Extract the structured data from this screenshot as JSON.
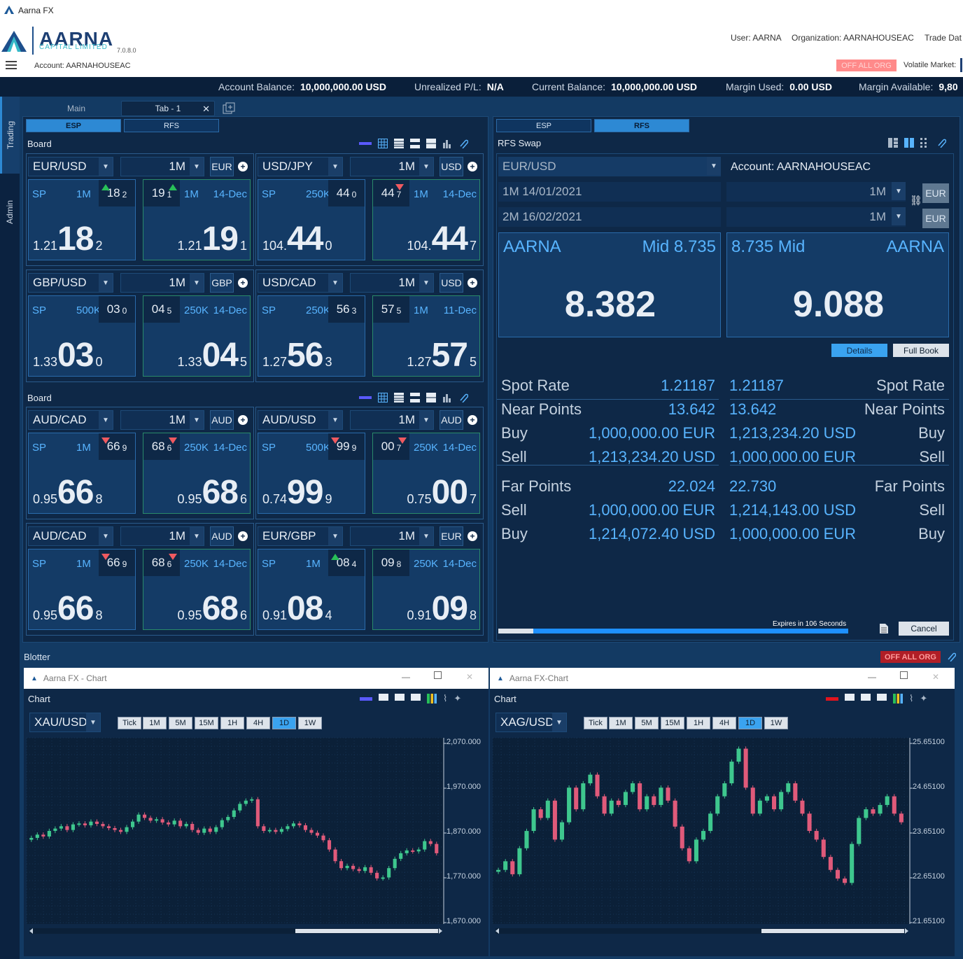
{
  "app": {
    "title": "Aarna FX",
    "logo_main": "AARNA",
    "logo_sub": "CAPITAL LIMITED",
    "version": "7.0.8.0"
  },
  "header": {
    "user": "User: AARNA",
    "organization": "Organization: AARNAHOUSEAC",
    "trade_date": "Trade Dat",
    "account": "Account: AARNAHOUSEAC",
    "off_all_org": "OFF ALL ORG",
    "volatile_market": "Volatile Market:"
  },
  "balances": [
    {
      "label": "Account Balance:",
      "value": "10,000,000.00 USD"
    },
    {
      "label": "Unrealized P/L:",
      "value": "N/A"
    },
    {
      "label": "Current Balance:",
      "value": "10,000,000.00 USD"
    },
    {
      "label": "Margin Used:",
      "value": "0.00 USD"
    },
    {
      "label": "Margin Available:",
      "value": "9,80"
    }
  ],
  "rail": {
    "trading": "Trading",
    "admin": "Admin"
  },
  "tabs": {
    "main": "Main",
    "tab1": "Tab - 1"
  },
  "left_panel": {
    "esp": "ESP",
    "rfs": "RFS",
    "board1": "Board",
    "board2": "Board"
  },
  "tiles": [
    {
      "pair": "EUR/USD",
      "tenor": "1M",
      "ccy": "EUR",
      "sell": {
        "lbl": "SP",
        "amt": "1M",
        "pip": "18",
        "sub": "2",
        "pre": "1.21",
        "big": "18",
        "last": "2"
      },
      "buy": {
        "pip": "19",
        "sub": "1",
        "amt": "1M",
        "date": "14-Dec",
        "pre": "1.21",
        "big": "19",
        "last": "1"
      },
      "dir": "up"
    },
    {
      "pair": "USD/JPY",
      "tenor": "1M",
      "ccy": "USD",
      "sell": {
        "lbl": "SP",
        "amt": "250K",
        "pip": "44",
        "sub": "0",
        "pre": "104.",
        "big": "44",
        "last": "0"
      },
      "buy": {
        "pip": "44",
        "sub": "7",
        "amt": "1M",
        "date": "14-Dec",
        "pre": "104.",
        "big": "44",
        "last": "7"
      },
      "dir": "down_buy"
    },
    {
      "pair": "GBP/USD",
      "tenor": "1M",
      "ccy": "GBP",
      "sell": {
        "lbl": "SP",
        "amt": "500K",
        "pip": "03",
        "sub": "0",
        "pre": "1.33",
        "big": "03",
        "last": "0"
      },
      "buy": {
        "pip": "04",
        "sub": "5",
        "amt": "250K",
        "date": "14-Dec",
        "pre": "1.33",
        "big": "04",
        "last": "5"
      },
      "dir": "none"
    },
    {
      "pair": "USD/CAD",
      "tenor": "1M",
      "ccy": "USD",
      "sell": {
        "lbl": "SP",
        "amt": "250K",
        "pip": "56",
        "sub": "3",
        "pre": "1.27",
        "big": "56",
        "last": "3"
      },
      "buy": {
        "pip": "57",
        "sub": "5",
        "amt": "1M",
        "date": "11-Dec",
        "pre": "1.27",
        "big": "57",
        "last": "5"
      },
      "dir": "none"
    },
    {
      "pair": "AUD/CAD",
      "tenor": "1M",
      "ccy": "AUD",
      "sell": {
        "lbl": "SP",
        "amt": "1M",
        "pip": "66",
        "sub": "9",
        "pre": "0.95",
        "big": "66",
        "last": "8"
      },
      "buy": {
        "pip": "68",
        "sub": "6",
        "amt": "250K",
        "date": "14-Dec",
        "pre": "0.95",
        "big": "68",
        "last": "6"
      },
      "dir": "down"
    },
    {
      "pair": "AUD/USD",
      "tenor": "1M",
      "ccy": "AUD",
      "sell": {
        "lbl": "SP",
        "amt": "500K",
        "pip": "99",
        "sub": "9",
        "pre": "0.74",
        "big": "99",
        "last": "9"
      },
      "buy": {
        "pip": "00",
        "sub": "7",
        "amt": "250K",
        "date": "14-Dec",
        "pre": "0.75",
        "big": "00",
        "last": "7"
      },
      "dir": "down"
    },
    {
      "pair": "AUD/CAD",
      "tenor": "1M",
      "ccy": "AUD",
      "sell": {
        "lbl": "SP",
        "amt": "1M",
        "pip": "66",
        "sub": "9",
        "pre": "0.95",
        "big": "66",
        "last": "8"
      },
      "buy": {
        "pip": "68",
        "sub": "6",
        "amt": "250K",
        "date": "14-Dec",
        "pre": "0.95",
        "big": "68",
        "last": "6"
      },
      "dir": "down"
    },
    {
      "pair": "EUR/GBP",
      "tenor": "1M",
      "ccy": "EUR",
      "sell": {
        "lbl": "SP",
        "amt": "1M",
        "pip": "08",
        "sub": "4",
        "pre": "0.91",
        "big": "08",
        "last": "4"
      },
      "buy": {
        "pip": "09",
        "sub": "8",
        "amt": "250K",
        "date": "14-Dec",
        "pre": "0.91",
        "big": "09",
        "last": "8"
      },
      "dir": "up_sell"
    }
  ],
  "rfs": {
    "esp": "ESP",
    "rfs": "RFS",
    "title": "RFS Swap",
    "pair": "EUR/USD",
    "account": "Account:  AARNAHOUSEAC",
    "near_date": "1M 14/01/2021",
    "far_date": "2M 16/02/2021",
    "near_tenor": "1M",
    "far_tenor": "1M",
    "ccy1": "EUR",
    "ccy2": "EUR",
    "left_name": "AARNA",
    "left_mid": "Mid 8.735",
    "left_price": "8.382",
    "right_mid": "8.735 Mid",
    "right_name": "AARNA",
    "right_price": "9.088",
    "details": "Details",
    "fullbook": "Full Book",
    "expires": "Expires in 106 Seconds",
    "cancel": "Cancel",
    "progress": 0.1,
    "rows": [
      {
        "l": "Spot Rate",
        "lv": "1.21187",
        "rv": "1.21187",
        "r": "Spot Rate"
      },
      {
        "l": "Near Points",
        "lv": "13.642",
        "rv": "13.642",
        "r": "Near Points"
      },
      {
        "l": "Buy",
        "lv": "1,000,000.00 EUR",
        "rv": "1,213,234.20 USD",
        "r": "Buy"
      },
      {
        "l": "Sell",
        "lv": "1,213,234.20 USD",
        "rv": "1,000,000.00 EUR",
        "r": "Sell"
      },
      {
        "l": "Far Points",
        "lv": "22.024",
        "rv": "22.730",
        "r": "Far Points"
      },
      {
        "l": "Sell",
        "lv": "1,000,000.00 EUR",
        "rv": "1,214,143.00 USD",
        "r": "Sell"
      },
      {
        "l": "Buy",
        "lv": "1,214,072.40 USD",
        "rv": "1,000,000.00 EUR",
        "r": "Buy"
      }
    ]
  },
  "blotter": {
    "title": "Blotter",
    "off_all_org": "OFF ALL ORG"
  },
  "charts": [
    {
      "win_title": "Aarna FX - Chart",
      "title": "Chart",
      "symbol": "XAU/USD",
      "timeframes": [
        "Tick",
        "1M",
        "5M",
        "15M",
        "1H",
        "4H",
        "1D",
        "1W"
      ],
      "active_tf": "1D",
      "yticks": [
        "2,070.000",
        "1,970.000",
        "1,870.000",
        "1,770.000",
        "1,670.000"
      ],
      "ymin": 1670,
      "ymax": 2070,
      "close": [
        1855,
        1862,
        1858,
        1870,
        1875,
        1880,
        1872,
        1884,
        1886,
        1882,
        1890,
        1885,
        1880,
        1876,
        1872,
        1868,
        1878,
        1890,
        1905,
        1898,
        1892,
        1895,
        1888,
        1884,
        1892,
        1880,
        1885,
        1872,
        1866,
        1875,
        1868,
        1878,
        1893,
        1900,
        1914,
        1928,
        1935,
        1938,
        1880,
        1870,
        1872,
        1868,
        1874,
        1880,
        1886,
        1882,
        1872,
        1866,
        1860,
        1850,
        1830,
        1805,
        1790,
        1795,
        1788,
        1784,
        1792,
        1780,
        1768,
        1770,
        1790,
        1810,
        1822,
        1828,
        1826,
        1830,
        1848,
        1842,
        1822
      ]
    },
    {
      "win_title": "Aarna FX-Chart",
      "title": "Chart",
      "symbol": "XAG/USD",
      "timeframes": [
        "Tick",
        "1M",
        "5M",
        "15M",
        "1H",
        "4H",
        "1D",
        "1W"
      ],
      "active_tf": "1D",
      "yticks": [
        "25.65100",
        "24.65100",
        "23.65100",
        "22.65100",
        "21.65100"
      ],
      "ymin": 21.651,
      "ymax": 25.951,
      "close": [
        22.9,
        23.1,
        22.8,
        23.4,
        23.8,
        24.3,
        24.1,
        24.5,
        23.6,
        24.0,
        24.8,
        24.3,
        24.9,
        25.1,
        24.6,
        24.2,
        24.5,
        24.4,
        24.7,
        24.9,
        24.3,
        24.6,
        24.4,
        24.8,
        24.5,
        23.9,
        23.4,
        23.1,
        23.6,
        23.8,
        24.2,
        24.6,
        24.9,
        25.4,
        25.7,
        24.8,
        24.2,
        24.5,
        24.6,
        24.3,
        24.7,
        24.9,
        24.5,
        24.2,
        23.8,
        23.6,
        23.2,
        22.9,
        22.7,
        22.6,
        23.5,
        24.1,
        24.3,
        24.2,
        24.4,
        24.6,
        24.2,
        24.0
      ]
    }
  ]
}
